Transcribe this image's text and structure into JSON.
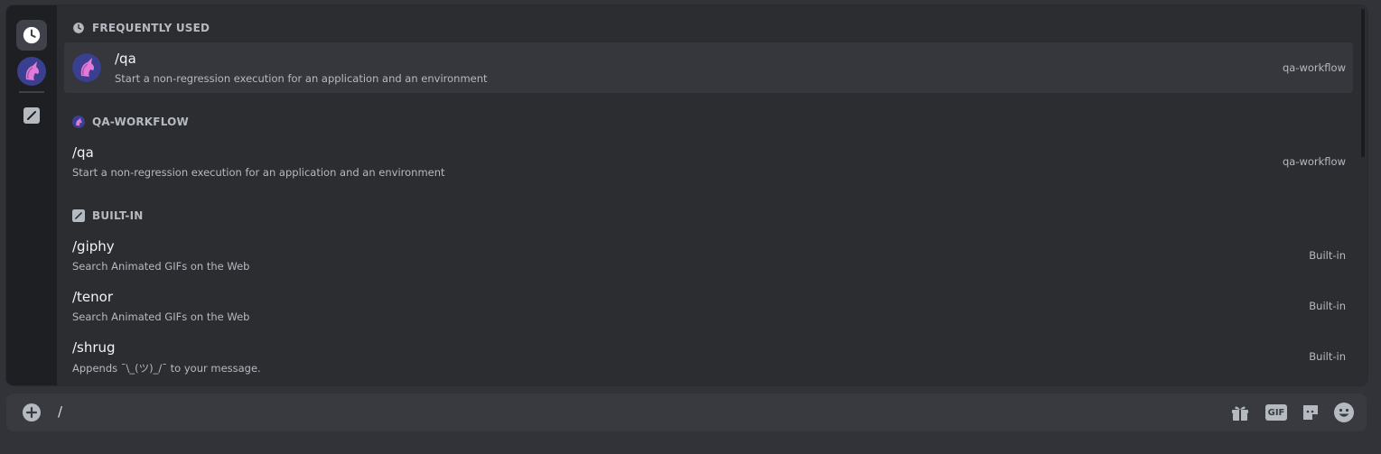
{
  "rail": {
    "items": [
      {
        "icon": "clock-icon"
      },
      {
        "icon": "unicorn-avatar-icon"
      },
      {
        "icon": "builtin-slash-icon"
      }
    ]
  },
  "sections": {
    "frequent": {
      "title": "FREQUENTLY USED",
      "icon": "clock-icon"
    },
    "qa": {
      "title": "QA-WORKFLOW",
      "icon": "unicorn-avatar-icon"
    },
    "builtin": {
      "title": "BUILT-IN",
      "icon": "builtin-slash-icon"
    }
  },
  "commands": {
    "frequent_qa": {
      "name": "/qa",
      "desc": "Start a non-regression execution for an application and an environment",
      "source": "qa-workflow"
    },
    "qa": {
      "name": "/qa",
      "desc": "Start a non-regression execution for an application and an environment",
      "source": "qa-workflow"
    },
    "giphy": {
      "name": "/giphy",
      "desc": "Search Animated GIFs on the Web",
      "source": "Built-in"
    },
    "tenor": {
      "name": "/tenor",
      "desc": "Search Animated GIFs on the Web",
      "source": "Built-in"
    },
    "shrug": {
      "name": "/shrug",
      "desc": "Appends ¯\\_(ツ)_/¯ to your message.",
      "source": "Built-in"
    }
  },
  "chat": {
    "input_value": "/",
    "tools": [
      "gift-icon",
      "gif-icon",
      "sticker-icon",
      "emoji-icon"
    ],
    "gif_label": "GIF"
  },
  "colors": {
    "background": "#313338",
    "popup": "#2b2d31",
    "rail": "#1e1f22",
    "selected_row": "#35373c",
    "avatar_bg": "#3b3f8f",
    "unicorn": "#e07bd8"
  }
}
